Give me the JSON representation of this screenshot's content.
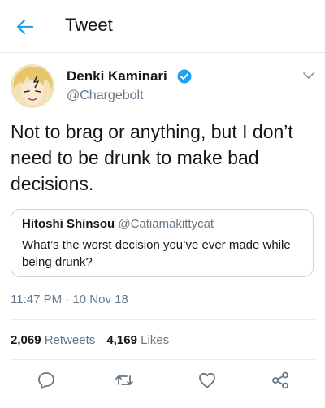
{
  "header": {
    "title": "Tweet",
    "back_icon": "arrow-left-icon"
  },
  "colors": {
    "accent": "#1da1f2",
    "secondary_text": "#657786",
    "divider": "#e6ecf0"
  },
  "tweet": {
    "author_name": "Denki Kaminari",
    "author_handle": "@Chargebolt",
    "verified": true,
    "text": "Not to brag or anything, but I don’t need to be drunk to make bad decisions.",
    "timestamp": "11:47 PM · 10 Nov 18",
    "quote": {
      "name": "Hitoshi Shinsou",
      "handle": "@Catiamakittycat",
      "text": "What’s the worst decision you’ve ever made while being drunk?"
    },
    "stats": {
      "retweets_count": "2,069",
      "retweets_label": "Retweets",
      "likes_count": "4,169",
      "likes_label": "Likes"
    }
  },
  "actions": [
    "reply-icon",
    "retweet-icon",
    "like-icon",
    "share-icon"
  ]
}
